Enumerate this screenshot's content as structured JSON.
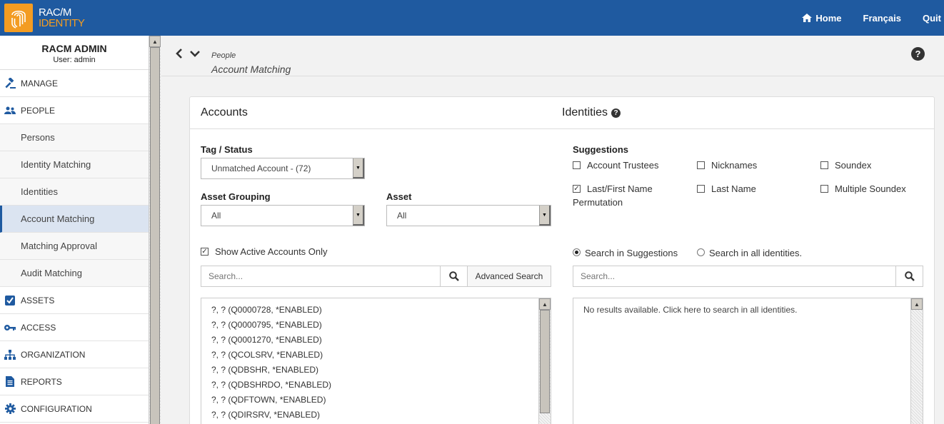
{
  "brand": {
    "line1": "RAC/M",
    "line2": "IDENTITY"
  },
  "topnav": {
    "home": "Home",
    "language": "Français",
    "quit": "Quit"
  },
  "user": {
    "name": "RACM ADMIN",
    "sub": "User: admin"
  },
  "sidebar": {
    "manage": "MANAGE",
    "people": "PEOPLE",
    "persons": "Persons",
    "identity_matching": "Identity Matching",
    "identities": "Identities",
    "account_matching": "Account Matching",
    "matching_approval": "Matching Approval",
    "audit_matching": "Audit Matching",
    "assets": "ASSETS",
    "access": "ACCESS",
    "organization": "ORGANIZATION",
    "reports": "REPORTS",
    "configuration": "CONFIGURATION"
  },
  "breadcrumb": {
    "parent": "People",
    "current": "Account Matching"
  },
  "accounts": {
    "title": "Accounts",
    "tag_status_label": "Tag / Status",
    "tag_status_value": "Unmatched Account - (72)",
    "asset_grouping_label": "Asset Grouping",
    "asset_grouping_value": "All",
    "asset_label": "Asset",
    "asset_value": "All",
    "active_only_label": "Show Active Accounts Only",
    "search_placeholder": "Search...",
    "advanced_search": "Advanced Search",
    "items": [
      "?, ? (Q0000728, *ENABLED)",
      "?, ? (Q0000795, *ENABLED)",
      "?, ? (Q0001270, *ENABLED)",
      "?, ? (QCOLSRV, *ENABLED)",
      "?, ? (QDBSHR, *ENABLED)",
      "?, ? (QDBSHRDO, *ENABLED)",
      "?, ? (QDFTOWN, *ENABLED)",
      "?, ? (QDIRSRV, *ENABLED)"
    ]
  },
  "identities": {
    "title": "Identities",
    "suggestions_label": "Suggestions",
    "opt_account_trustees": "Account Trustees",
    "opt_nicknames": "Nicknames",
    "opt_soundex": "Soundex",
    "opt_last_first_1": "Last/First Name",
    "opt_last_first_2": "Permutation",
    "opt_last_name": "Last Name",
    "opt_multiple_soundex": "Multiple Soundex",
    "radio_suggestions": "Search in Suggestions",
    "radio_all": "Search in all identities.",
    "search_placeholder": "Search...",
    "no_results": "No results available. Click here to search in all identities."
  }
}
